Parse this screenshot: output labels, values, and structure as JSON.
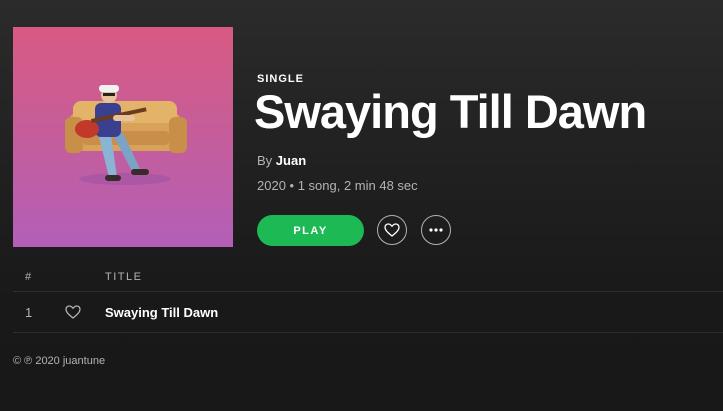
{
  "album": {
    "kind_label": "SINGLE",
    "title": "Swaying Till Dawn",
    "by_prefix": "By",
    "artist": "Juan",
    "meta": "2020 • 1 song, 2 min 48 sec"
  },
  "actions": {
    "play_label": "PLAY",
    "like_icon": "heart-outline-icon",
    "more_icon": "more-dots-icon"
  },
  "tracklist": {
    "headers": {
      "number": "#",
      "title": "TITLE"
    },
    "tracks": [
      {
        "number": "1",
        "title": "Swaying Till Dawn"
      }
    ]
  },
  "footer": {
    "copyright": "© ℗ 2020 juantune"
  },
  "colors": {
    "accent": "#1db954",
    "background": "#181818",
    "text_secondary": "#b3b3b3"
  }
}
